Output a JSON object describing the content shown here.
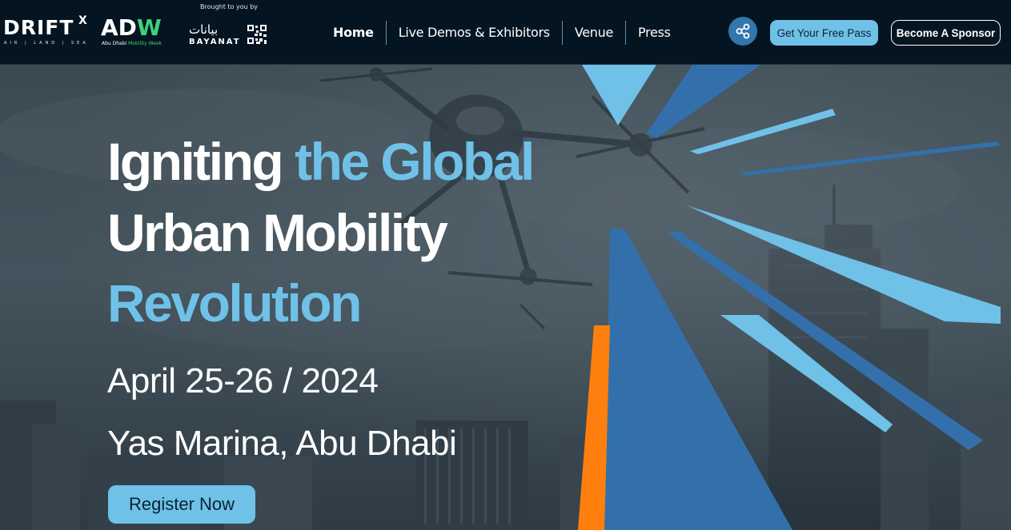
{
  "logos": {
    "driftx": {
      "word": "DRIFT",
      "sup": "X",
      "sub": "AIR | LAND | SEA"
    },
    "adw": {
      "word_a": "AD",
      "word_w": "W",
      "sub_prefix": "Abu Dhabi",
      "sub_green": "Mobility Week"
    },
    "brought_by": "Brought to you by",
    "bayanat": {
      "arabic": "بيانات",
      "latin": "BAYANAT"
    }
  },
  "nav": {
    "items": [
      {
        "label": "Home",
        "active": true
      },
      {
        "label": "Live Demos & Exhibitors"
      },
      {
        "label": "Venue"
      },
      {
        "label": "Press"
      }
    ]
  },
  "header_actions": {
    "share_icon": "share-icon",
    "free_pass_label": "Get Your Free Pass",
    "sponsor_label": "Become A Sponsor"
  },
  "hero": {
    "headline_1a": "Igniting ",
    "headline_1b": "the Global",
    "headline_2": "Urban Mobility",
    "headline_3": "Revolution",
    "date": "April 25-26 / 2024",
    "venue": "Yas Marina, Abu Dhabi",
    "register_label": "Register Now"
  },
  "colors": {
    "header_bg": "#041521",
    "accent_light_blue": "#6fc1e8",
    "accent_blue": "#3370ab",
    "accent_orange": "#ff7f0e",
    "adw_green": "#3fd07a"
  }
}
